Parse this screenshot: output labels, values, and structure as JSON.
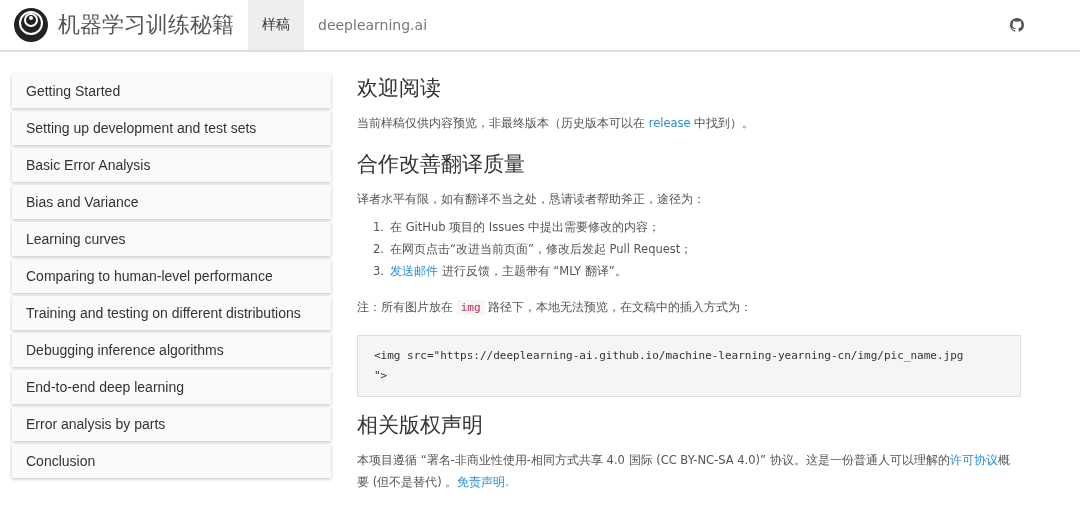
{
  "header": {
    "title": "机器学习训练秘籍",
    "tabs": [
      {
        "label": "样稿",
        "selected": true
      },
      {
        "label": "deeplearning.ai",
        "selected": false
      }
    ]
  },
  "sidebar": {
    "items": [
      {
        "label": "Getting Started"
      },
      {
        "label": "Setting up development and test sets"
      },
      {
        "label": "Basic Error Analysis"
      },
      {
        "label": "Bias and Variance"
      },
      {
        "label": "Learning curves"
      },
      {
        "label": "Comparing to human-level performance"
      },
      {
        "label": "Training and testing on different distributions"
      },
      {
        "label": "Debugging inference algorithms"
      },
      {
        "label": "End-to-end deep learning"
      },
      {
        "label": "Error analysis by parts"
      },
      {
        "label": "Conclusion"
      }
    ]
  },
  "content": [
    {
      "kind": "heading",
      "text": "欢迎阅读"
    },
    {
      "kind": "paragraph",
      "parts": [
        {
          "text": "当前样稿仅供内容预览，非最终版本（历史版本可以在 "
        },
        {
          "text": "release",
          "link": true
        },
        {
          "text": " 中找到）。"
        }
      ]
    },
    {
      "kind": "heading",
      "text": "合作改善翻译质量"
    },
    {
      "kind": "paragraph",
      "parts": [
        {
          "text": "译者水平有限，如有翻译不当之处，恳请读者帮助斧正，途径为："
        }
      ]
    },
    {
      "kind": "list",
      "items": [
        {
          "number": "1.",
          "parts": [
            {
              "text": "在 GitHub 项目的 Issues 中提出需要修改的内容；"
            }
          ]
        },
        {
          "number": "2.",
          "parts": [
            {
              "text": "在网页点击“改进当前页面”，修改后发起 Pull Request；"
            }
          ]
        },
        {
          "number": "3.",
          "parts": [
            {
              "text": "发送邮件",
              "link": true
            },
            {
              "text": " 进行反馈，主题带有 “MLY 翻译”。"
            }
          ]
        }
      ]
    },
    {
      "kind": "paragraph",
      "parts": [
        {
          "text": "注：所有图片放在 "
        },
        {
          "text": "img",
          "code": true
        },
        {
          "text": " 路径下，本地无法预览，在文稿中的插入方式为："
        }
      ]
    },
    {
      "kind": "code",
      "text": "<img src=\"https://deeplearning-ai.github.io/machine-learning-yearning-cn/img/pic_name.jpg\n\">"
    },
    {
      "kind": "heading",
      "text": "相关版权声明"
    },
    {
      "kind": "paragraph",
      "parts": [
        {
          "text": "本项目遵循 “署名-非商业性使用-相同方式共享 4.0 国际 (CC BY-NC-SA 4.0)” 协议。这是一份普通人可以理解的"
        },
        {
          "text": "许可协议",
          "link": true
        },
        {
          "text": "概要 (但不是替代) 。"
        },
        {
          "text": "免责声明.",
          "link": true
        }
      ]
    }
  ]
}
